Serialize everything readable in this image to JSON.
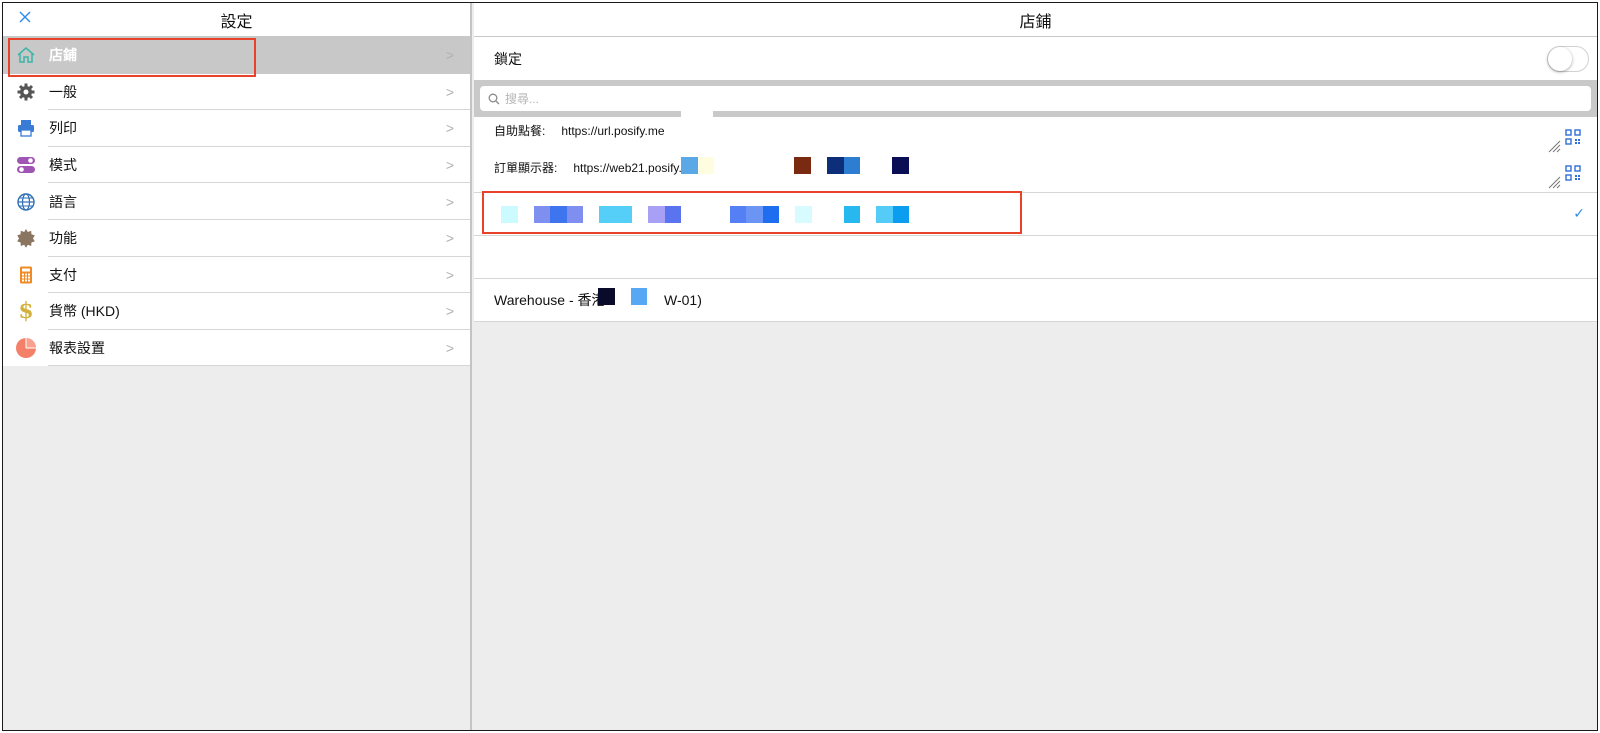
{
  "left_panel": {
    "title": "設定",
    "close_icon": "close-icon",
    "items": [
      {
        "label": "店鋪",
        "icon": "home-icon",
        "selected": true
      },
      {
        "label": "一般",
        "icon": "gear-icon"
      },
      {
        "label": "列印",
        "icon": "printer-icon"
      },
      {
        "label": "模式",
        "icon": "toggle-icon"
      },
      {
        "label": "語言",
        "icon": "globe-icon"
      },
      {
        "label": "功能",
        "icon": "sun-badge-icon"
      },
      {
        "label": "支付",
        "icon": "calculator-icon"
      },
      {
        "label": "貨幣 (HKD)",
        "icon": "dollar-icon"
      },
      {
        "label": "報表設置",
        "icon": "pie-chart-icon"
      }
    ]
  },
  "right_panel": {
    "title": "店鋪",
    "lock": {
      "label": "鎖定",
      "enabled": false
    },
    "search": {
      "placeholder": "搜尋..."
    },
    "urls": [
      {
        "label": "自助點餐:",
        "value": "https://url.posify.me"
      },
      {
        "label": "訂單顯示器:",
        "value": "https://web21.posify.m"
      }
    ],
    "stores": [
      {
        "name": "",
        "selected": true
      },
      {
        "name": ""
      },
      {
        "name": "Warehouse - 香港",
        "code_suffix": "W-01)"
      }
    ]
  },
  "colors": {
    "accent": "#2f8be8",
    "highlight": "#e8432a",
    "selected_bg": "#c8c8c8"
  }
}
